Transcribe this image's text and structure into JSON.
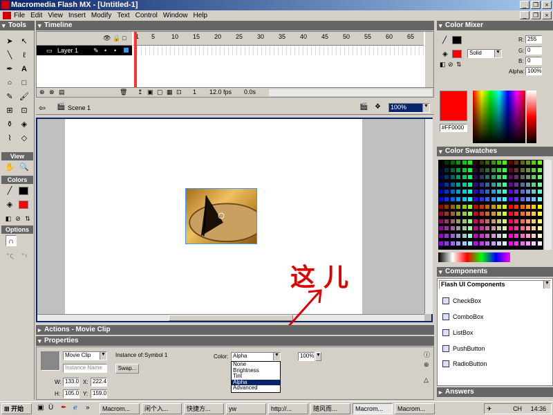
{
  "window": {
    "title": "Macromedia Flash MX - [Untitled-1]"
  },
  "menu": [
    "File",
    "Edit",
    "View",
    "Insert",
    "Modify",
    "Text",
    "Control",
    "Window",
    "Help"
  ],
  "tools": {
    "title": "Tools",
    "view": "View",
    "colors": "Colors",
    "options": "Options"
  },
  "timeline": {
    "title": "Timeline",
    "layer": "Layer 1",
    "ruler": [
      "1",
      "5",
      "10",
      "15",
      "20",
      "25",
      "30",
      "35",
      "40",
      "45",
      "50",
      "55",
      "60",
      "65"
    ],
    "frame": "1",
    "fps": "12.0 fps",
    "time": "0.0s"
  },
  "scene": {
    "label": "Scene 1",
    "zoom": "100%"
  },
  "annotation": {
    "text": "这儿"
  },
  "actions": {
    "title": "Actions - Movie Clip"
  },
  "properties": {
    "title": "Properties",
    "type": "Movie Clip",
    "instance_placeholder": "Instance Name",
    "instance_of_label": "Instance of:",
    "instance_of": "Symbol 1",
    "swap": "Swap...",
    "color_label": "Color:",
    "color_value": "Alpha",
    "color_options": [
      "None",
      "Brightness",
      "Tint",
      "Alpha",
      "Advanced"
    ],
    "alpha": "100%",
    "w": "133.0",
    "x": "222.4",
    "h": "105.0",
    "y": "159.0",
    "w_label": "W:",
    "x_label": "X:",
    "h_label": "H:",
    "y_label": "Y:"
  },
  "mixer": {
    "title": "Color Mixer",
    "fill": "Solid",
    "r": "255",
    "g": "0",
    "b": "0",
    "alpha": "100%",
    "hex": "#FF0000",
    "r_label": "R:",
    "g_label": "G:",
    "b_label": "B:",
    "alpha_label": "Alpha:"
  },
  "swatches": {
    "title": "Color Swatches"
  },
  "components": {
    "title": "Components",
    "set": "Flash UI Components",
    "items": [
      "CheckBox",
      "ComboBox",
      "ListBox",
      "PushButton",
      "RadioButton"
    ]
  },
  "answers": {
    "title": "Answers"
  },
  "taskbar": {
    "start": "开始",
    "items": [
      "Macrom...",
      "闲个入...",
      "快捷方...",
      "yw",
      "http://...",
      "随风而...",
      "Macrom...",
      "Macrom..."
    ],
    "time": "14:36",
    "ime": "CH"
  },
  "colors": {
    "red": "#ff0000",
    "stage_bg": "#ffffff",
    "workspace": "#c0c0c0",
    "panel_header": "#666666",
    "annotation": "#dd0000"
  }
}
